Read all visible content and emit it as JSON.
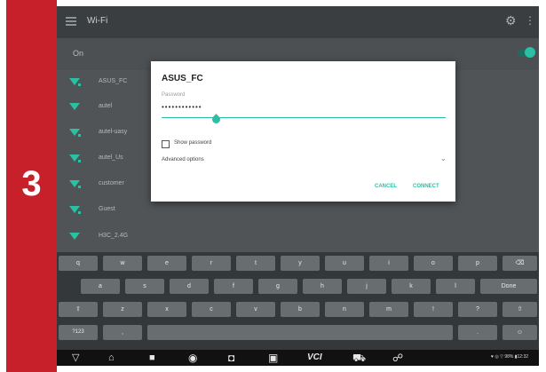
{
  "step": {
    "number": "3"
  },
  "action_bar": {
    "title": "Wi-Fi",
    "gear_glyph": "⚙",
    "overflow_glyph": "⋮"
  },
  "switch_bar": {
    "label": "On"
  },
  "networks": [
    "ASUS_FC",
    "autel",
    "autel-uasy",
    "autel_Us",
    "customer",
    "Guest",
    "H3C_2.4G"
  ],
  "dialog": {
    "title": "ASUS_FC",
    "password_label": "Password",
    "password_value": "••••••••••••",
    "show_password": "Show password",
    "advanced_options": "Advanced options",
    "chevron": "⌄",
    "cancel": "CANCEL",
    "connect": "CONNECT"
  },
  "keyboard": {
    "row1": [
      "q",
      "w",
      "e",
      "r",
      "t",
      "y",
      "u",
      "i",
      "o",
      "p",
      "⌫"
    ],
    "row2": [
      "a",
      "s",
      "d",
      "f",
      "g",
      "h",
      "j",
      "k",
      "l",
      "Done"
    ],
    "row3": [
      "⇧",
      "z",
      "x",
      "c",
      "v",
      "b",
      "n",
      "m",
      "!",
      "?",
      "⇧"
    ],
    "row4": [
      "?123",
      ",",
      "",
      ".",
      "☺"
    ]
  },
  "navbar": {
    "back": "▽",
    "home": "⌂",
    "recents": "■",
    "vci": "VCI",
    "status": "♥ ◎ ▽ 98% ▮12:32"
  },
  "colors": {
    "accent": "#2bbfa4",
    "step_red": "#c8202a"
  }
}
